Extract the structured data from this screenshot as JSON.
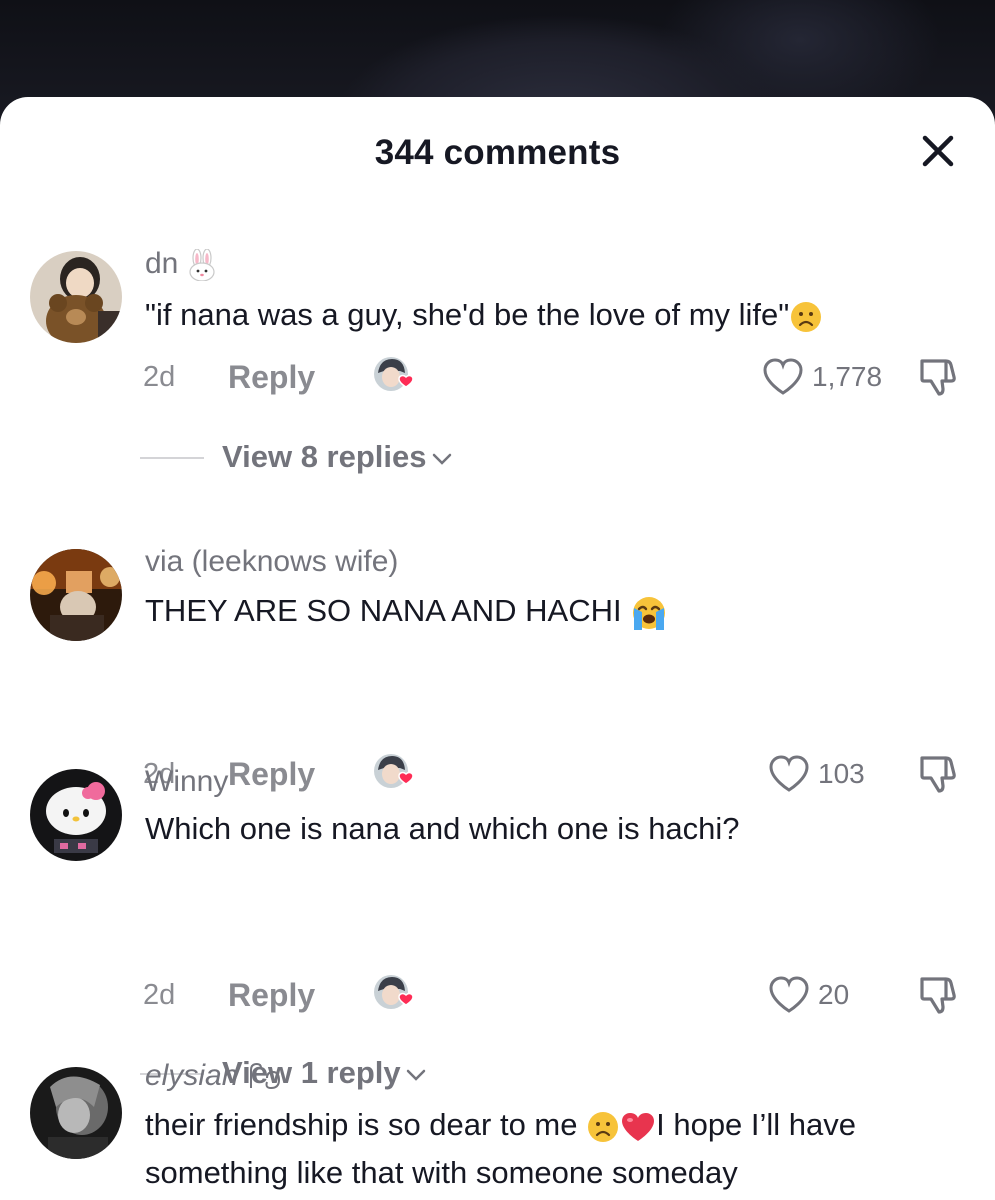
{
  "header": {
    "title": "344 comments",
    "close_icon": "close-icon"
  },
  "comments": [
    {
      "username": "dn",
      "username_emoji": "rabbit-face-emoji",
      "text": "\"if nana was a guy, she'd be the love of my life\"",
      "text_emoji": "frowning-face-emoji",
      "time": "2d",
      "reply_label": "Reply",
      "likes": "1,778",
      "view_replies": "View 8 replies"
    },
    {
      "username": "via (leeknows wife)",
      "text": "THEY ARE SO NANA AND HACHI",
      "text_emoji": "loudly-crying-face-emoji",
      "time": "2d",
      "reply_label": "Reply",
      "likes": "103"
    },
    {
      "username": "Winny",
      "text": "Which one is nana and which one is hachi?",
      "time": "2d",
      "reply_label": "Reply",
      "likes": "20",
      "view_replies": "View 1 reply"
    },
    {
      "username": "elysian",
      "username_emoji": "thai-script-glyphs",
      "text_a": "their friendship is so dear to me ",
      "text_b": "I hope I’ll have something like that with someone someday",
      "text_emojis": [
        "frowning-face-emoji",
        "red-heart-emoji"
      ]
    }
  ],
  "colors": {
    "title": "#161823",
    "secondary": "#73747c",
    "heart_badge": "#fe2c55"
  }
}
